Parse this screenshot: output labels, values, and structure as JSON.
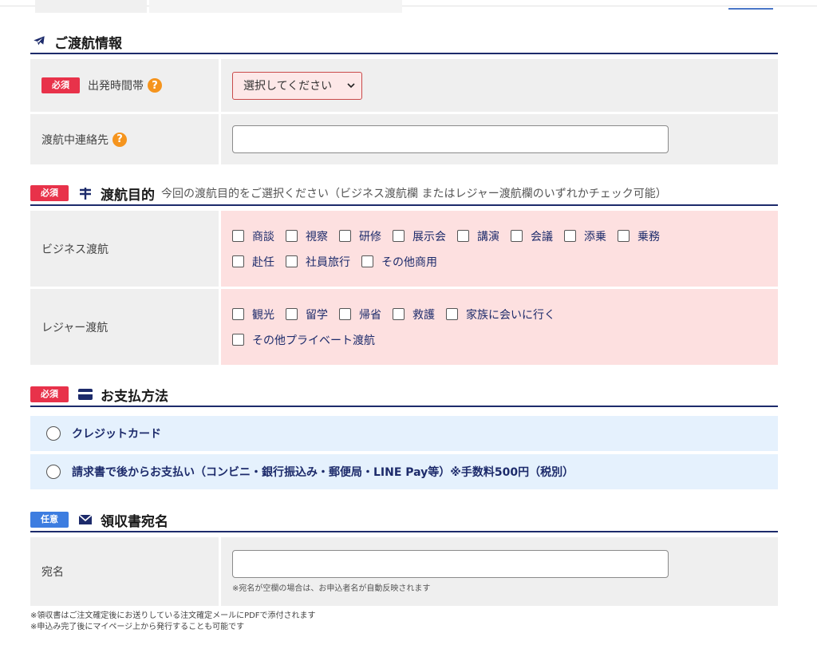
{
  "flight": {
    "title": "ご渡航情報",
    "required_badge": "必須",
    "departure_label": "出発時間帯",
    "departure_select": "選択してください",
    "contact_label": "渡航中連絡先"
  },
  "purpose": {
    "badge": "必須",
    "title": "渡航目的",
    "subtitle": "今回の渡航目的をご選択ください（ビジネス渡航欄 またはレジャー渡航欄のいずれかチェック可能）",
    "business_label": "ビジネス渡航",
    "business_options": [
      "商談",
      "視察",
      "研修",
      "展示会",
      "講演",
      "会議",
      "添乗",
      "乗務",
      "赴任",
      "社員旅行",
      "その他商用"
    ],
    "leisure_label": "レジャー渡航",
    "leisure_options": [
      "観光",
      "留学",
      "帰省",
      "救護",
      "家族に会いに行く",
      "その他プライベート渡航"
    ]
  },
  "payment": {
    "badge": "必須",
    "title": "お支払方法",
    "option1": "クレジットカード",
    "option2": "請求書で後からお支払い（コンビニ・銀行振込み・郵便局・LINE Pay等）※手数料500円（税別）"
  },
  "receipt": {
    "badge": "任意",
    "title": "領収書宛名",
    "field_label": "宛名",
    "field_note": "※宛名が空欄の場合は、お申込者名が自動反映されます",
    "note1": "※領収書はご注文確定後にお送りしている注文確定メールにPDFで添付されます",
    "note2": "※申込み完了後にマイページ上から発行することも可能です"
  },
  "colors": {
    "navy": "#1d2b6b",
    "required": "#e8324a",
    "optional": "#3d7de0",
    "pink_bg": "#fde0e0",
    "blue_bg": "#e5f1fd"
  }
}
